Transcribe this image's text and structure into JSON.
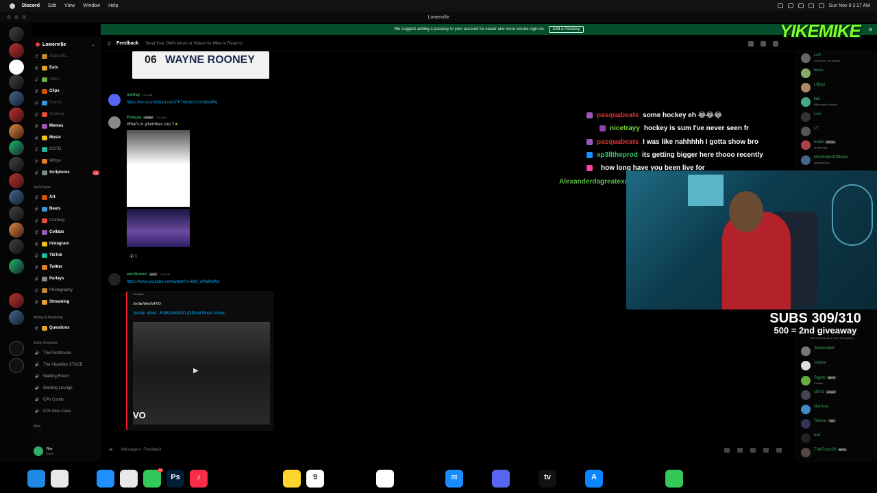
{
  "menubar": {
    "app": "Discord",
    "items": [
      "Edit",
      "View",
      "Window",
      "Help"
    ],
    "clock": "Sun Nov 9  2:17 AM"
  },
  "window": {
    "title": "Lowerville"
  },
  "banner": {
    "text": "We suggest adding a passkey to your account for easier and more secure sign-ins.",
    "button": "Add a Passkey"
  },
  "server": {
    "name": "Lowerville"
  },
  "channels": [
    {
      "name": "Subscrib...",
      "state": "muted"
    },
    {
      "name": "Eats",
      "state": "bright"
    },
    {
      "name": "Vibes",
      "state": "muted"
    },
    {
      "name": "Clips",
      "state": "bright"
    },
    {
      "name": "Events",
      "state": "muted"
    },
    {
      "name": "Gaming",
      "state": "muted"
    },
    {
      "name": "Memes",
      "state": "bright"
    },
    {
      "name": "Music",
      "state": "bright"
    },
    {
      "name": "OOTD",
      "state": "normal"
    },
    {
      "name": "Whips",
      "state": "normal"
    },
    {
      "name": "Scriptures",
      "state": "bright",
      "count": "16"
    }
  ],
  "self_promo": {
    "label": "Self Promo"
  },
  "promo_channels": [
    {
      "name": "Art",
      "state": "bright"
    },
    {
      "name": "Beats",
      "state": "bright"
    },
    {
      "name": "Clothing",
      "state": "normal"
    },
    {
      "name": "Collabs",
      "state": "bright"
    },
    {
      "name": "Instagram",
      "state": "bright"
    },
    {
      "name": "TikTok",
      "state": "bright"
    },
    {
      "name": "Twitter",
      "state": "bright"
    },
    {
      "name": "Parlays",
      "state": "bright"
    },
    {
      "name": "Photography",
      "state": "normal"
    },
    {
      "name": "Streaming",
      "state": "bright"
    }
  ],
  "mixing": {
    "label": "Mixing & Mastering",
    "channel": "Questions"
  },
  "voice": {
    "label": "Voice Channels",
    "channels": [
      "The Penthouse",
      "The YikeMike STAGE",
      "Waiting Room",
      "Gaming Lounge",
      "CPs Condo",
      "CPs Man Cave"
    ]
  },
  "bots": {
    "label": "Bots"
  },
  "user": {
    "name": "Yike",
    "status": "Online"
  },
  "chat": {
    "channel": "Feedback",
    "topic": "Send Your OWN Music or Videos for Mike to React to",
    "top_image_text": "WAYNE ROONEY",
    "top_image_num": "06",
    "messages": [
      {
        "user": "icetray",
        "time": "1:25 AM",
        "link": "https://on.soundcloud.com/7h7ohVyCU1o0jdo4Fq"
      },
      {
        "user": "Pasqua",
        "tag": "HONY",
        "time": "1:40 AM",
        "text": "What's in yikemikes cup ?",
        "reaction_count": "1"
      },
      {
        "user": "excitionxx",
        "tag": "UUG",
        "time": "1:55 AM",
        "link": "https://www.youtube.com/watch?v=ldM_eWaNoWk"
      }
    ],
    "embed": {
      "provider": "YouTube",
      "author": "JordanWardVEVO",
      "title": "Jordan Ward - FAMJAM4000 (Official Music Video)",
      "watermark": "VO"
    },
    "composer_placeholder": "Message #",
    "composer_channel": "Feedback"
  },
  "overlay_chat": [
    {
      "user": "pasquabeats",
      "msg": "some hockey eh 😂😂😂",
      "color": "#e0312e"
    },
    {
      "user": "nicetrayy",
      "msg": "hockey is sum I've never seen fr",
      "color": "#7ad33a"
    },
    {
      "user": "pasquabeats",
      "msg": "I was like nahhhhh I gotta show bro",
      "color": "#e0312e"
    },
    {
      "user": "xp3lltheprod",
      "msg": "its getting bigger here thooo recently",
      "color": "#37c86f"
    },
    {
      "user": "",
      "msg": "how long have you been live for",
      "color": "#3f5ed8"
    },
    {
      "user": "Alexanderdagreatexoxo",
      "msg": "yo",
      "color": "#57b846"
    }
  ],
  "stream": {
    "subs": "SUBS 309/310",
    "goal": "500 = 2nd giveaway",
    "logo": "YIKEMIKE"
  },
  "members": [
    {
      "name": "Lefl",
      "sub": "Got you in my system",
      "color": "green"
    },
    {
      "name": "levas",
      "color": "green"
    },
    {
      "name": "Lillyyy",
      "color": "green"
    },
    {
      "name": "lleil",
      "sub": "Billionaires' Bunker",
      "color": "green"
    },
    {
      "name": "Lon",
      "color": "green"
    },
    {
      "name": "LT",
      "color": "green"
    },
    {
      "name": "matix",
      "tag": "PROD",
      "sub": "on the way",
      "color": "green"
    },
    {
      "name": "MostHatedOfficials",
      "sub": "gg/district1oi",
      "color": "green"
    },
    {
      "name": "Sklamadeit",
      "color": "green"
    },
    {
      "name": "solace",
      "color": "green"
    },
    {
      "name": "Sqydd",
      "tag": "$$TR",
      "sub": "Fortnite",
      "color": "green"
    },
    {
      "name": "st0n3",
      "tag": "LOWR",
      "color": "green"
    },
    {
      "name": "starfuze",
      "color": "green"
    },
    {
      "name": "Tekaru",
      "tag": "TBC",
      "color": "green"
    },
    {
      "name": "text",
      "color": "green"
    },
    {
      "name": "TheFound3r",
      "tag": "MFIA",
      "color": "green"
    }
  ],
  "member_quote": "\"Be loved! Be jazz! You don't gotta L...",
  "dock": {
    "apps": [
      "Finder",
      "Launchpad",
      "Safari",
      "Chrome",
      "Messages",
      "Photoshop",
      "Music",
      "Calendar",
      "Notes",
      "Photos",
      "Mail",
      "Discord",
      "Apple TV",
      "App Store",
      "FaceTime"
    ],
    "calendar_day": "9",
    "messages_badge": "57"
  }
}
